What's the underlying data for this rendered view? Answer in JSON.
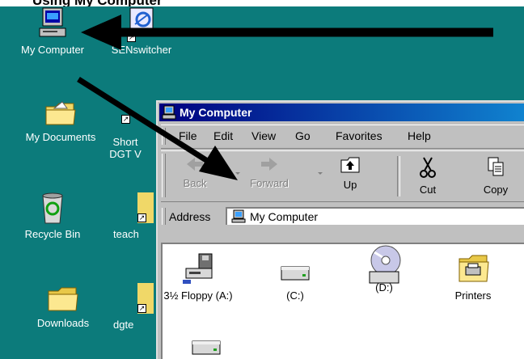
{
  "caption": "Using My Computer",
  "desktop": {
    "icons": [
      {
        "label": "My Computer"
      },
      {
        "label": "SENswitcher"
      },
      {
        "label": "My Documents"
      },
      {
        "label": "Short\nDGT V"
      },
      {
        "label": "Recycle Bin"
      },
      {
        "label": "teach"
      },
      {
        "label": "Downloads"
      },
      {
        "label": "dgte"
      }
    ]
  },
  "window": {
    "title": "My Computer",
    "menu": [
      "File",
      "Edit",
      "View",
      "Go",
      "Favorites",
      "Help"
    ],
    "toolbar": {
      "back": "Back",
      "forward": "Forward",
      "up": "Up",
      "cut": "Cut",
      "copy": "Copy"
    },
    "address": {
      "label": "Address",
      "value": "My Computer"
    },
    "items": [
      {
        "label": "3½ Floppy (A:)"
      },
      {
        "label": "(C:)"
      },
      {
        "label": "(D:)"
      },
      {
        "label": "Printers"
      },
      {
        "label": ""
      }
    ]
  },
  "colors": {
    "desktop": "#0c7b7b",
    "titlebar": "#000080",
    "window": "#c0c0c0"
  }
}
